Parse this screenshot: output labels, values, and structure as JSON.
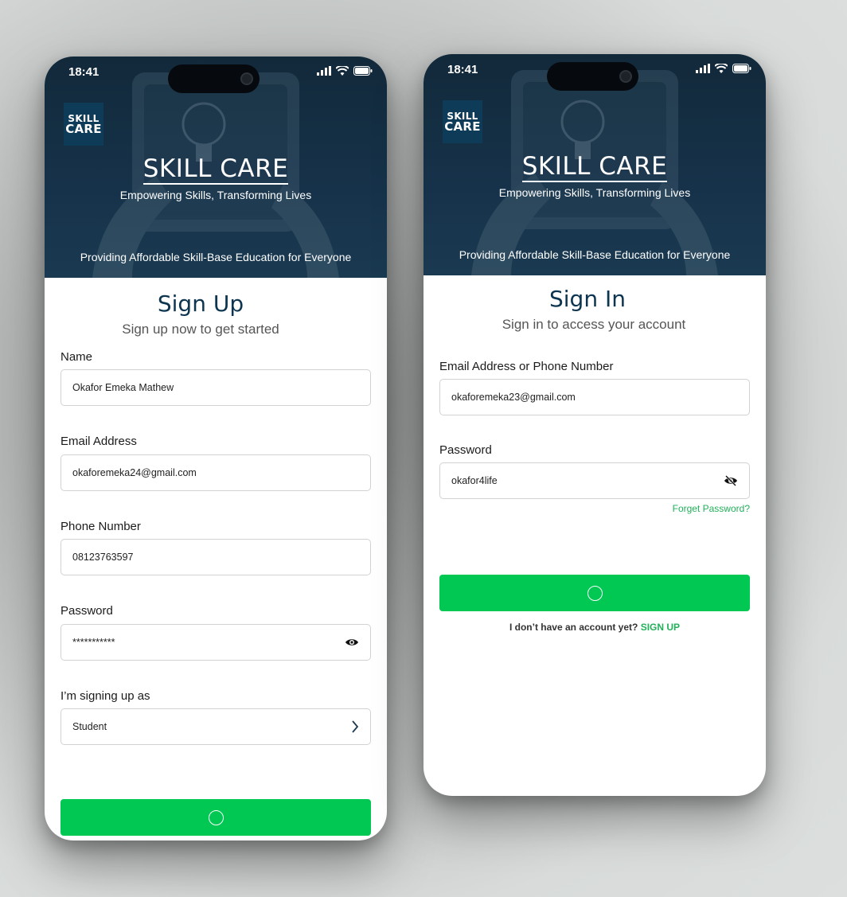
{
  "status_bar": {
    "time": "18:41"
  },
  "brand": {
    "logo_line1": "SKILL",
    "logo_line2": "CARE",
    "title": "SKILL CARE",
    "tagline": "Empowering Skills, Transforming Lives",
    "mission": "Providing Affordable Skill-Base Education for Everyone"
  },
  "signup": {
    "heading": "Sign Up",
    "subheading": "Sign up now to get started",
    "name_label": "Name",
    "name_value": "Okafor Emeka Mathew",
    "email_label": "Email Address",
    "email_value": "okaforemeka24@gmail.com",
    "phone_label": "Phone Number",
    "phone_value": "08123763597",
    "password_label": "Password",
    "password_value": "***********",
    "role_label": "I’m signing up as",
    "role_value": "Student",
    "icons": {
      "password_toggle": "eye-icon",
      "role_picker": "chevron-right-icon",
      "submit": "loading-spinner-icon"
    }
  },
  "signin": {
    "heading": "Sign In",
    "subheading": "Sign in to access your account",
    "identifier_label": "Email Address or Phone Number",
    "identifier_value": "okaforemeka23@gmail.com",
    "password_label": "Password",
    "password_value": "okafor4life",
    "forgot_label": "Forget Password?",
    "no_account_text": "I don’t have an account yet?",
    "signup_link": "SIGN UP",
    "icons": {
      "password_toggle": "eye-off-icon",
      "submit": "loading-spinner-icon"
    }
  },
  "colors": {
    "hero": "#16324a",
    "heading": "#0d3550",
    "accent_green": "#00c853",
    "link_green": "#21b15a",
    "logo_bg": "#0e3b57"
  }
}
